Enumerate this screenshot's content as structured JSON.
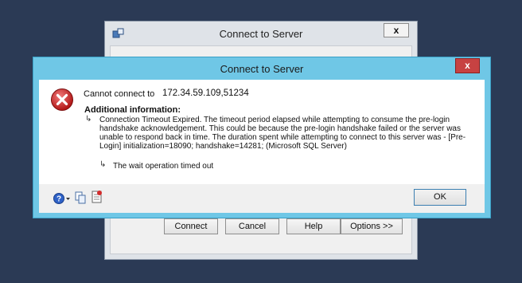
{
  "background_window": {
    "title": "Connect to Server",
    "close_label": "x",
    "buttons": {
      "connect": "Connect",
      "cancel": "Cancel",
      "help": "Help",
      "options": "Options >>"
    }
  },
  "dialog": {
    "title": "Connect to Server",
    "close_label": "x",
    "cannot_connect_label": "Cannot connect to",
    "server_address": "172.34.59.109,51234",
    "additional_info_heading": "Additional information:",
    "arrow_glyph": "↳",
    "message": "Connection Timeout Expired.  The timeout period elapsed while attempting to consume the pre-login handshake acknowledgement.  This could be because the pre-login handshake failed or the server was unable to respond back in time.  The duration spent while attempting to connect to this server was - [Pre-Login] initialization=18090; handshake=14281;  (Microsoft SQL Server)",
    "inner_message": "The wait operation timed out",
    "ok_label": "OK"
  },
  "colors": {
    "desktop": "#2b3a55",
    "dialog_frame": "#6fc7e6",
    "close_red": "#c74242",
    "error_red": "#d32b2b"
  },
  "icons": [
    "error-icon",
    "help-icon",
    "copy-icon",
    "details-icon",
    "app-icon"
  ]
}
